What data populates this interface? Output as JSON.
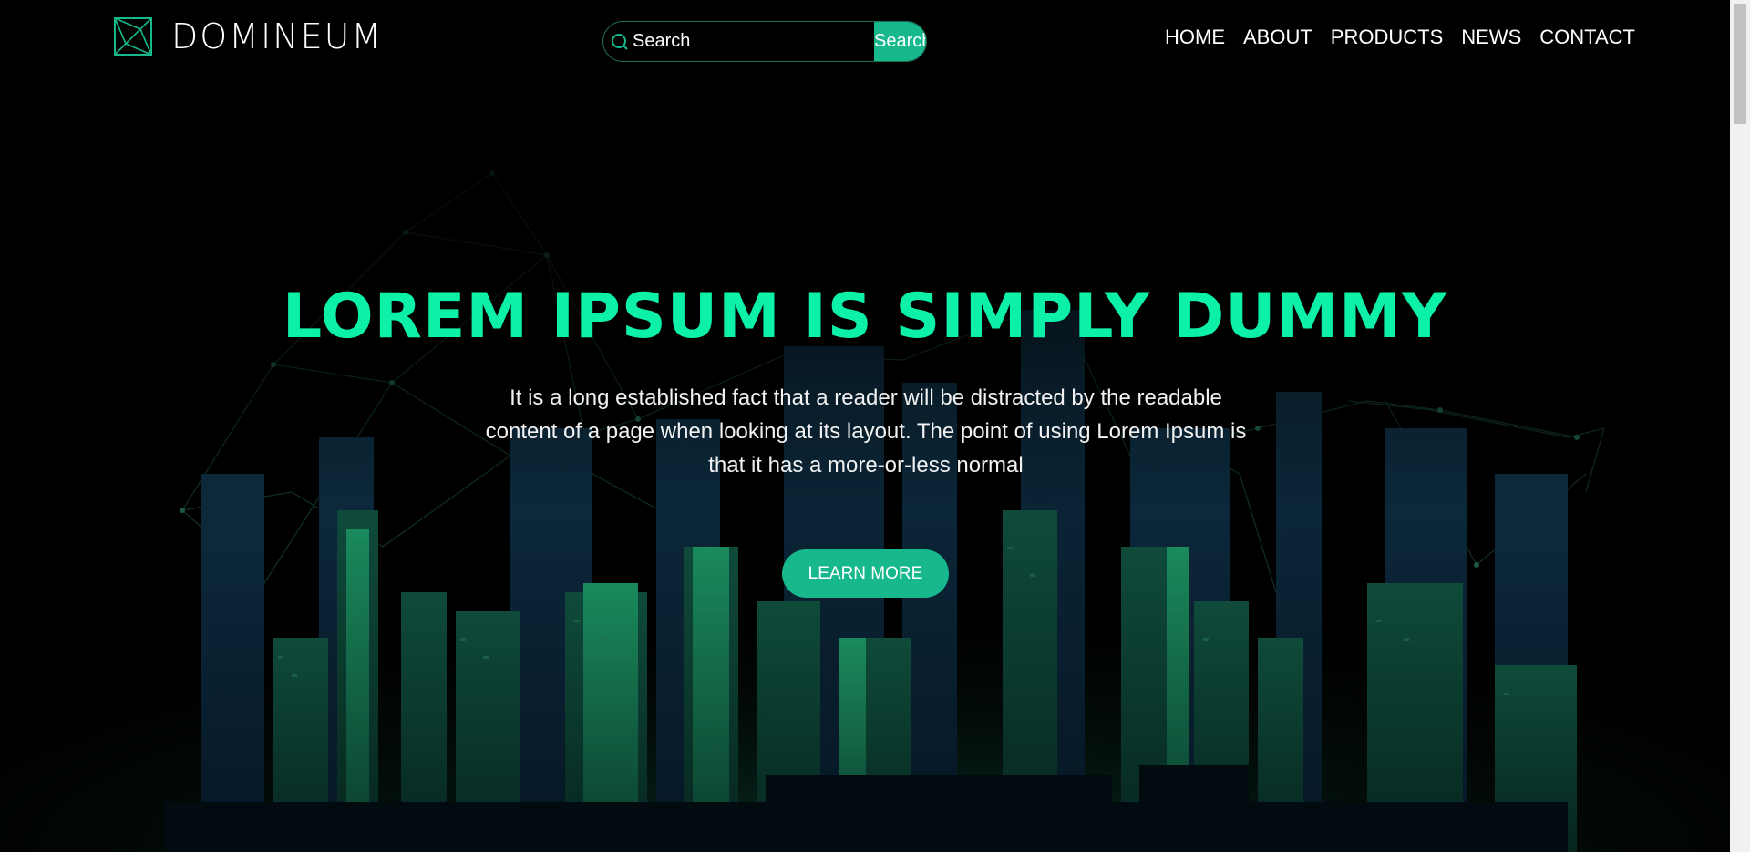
{
  "brand": {
    "name": "DOMINEUM",
    "logo_icon": "geometric-square-logo-icon"
  },
  "search": {
    "placeholder": "Search",
    "button_label": "Search",
    "icon": "search-icon"
  },
  "nav": {
    "items": [
      {
        "label": "HOME"
      },
      {
        "label": "ABOUT"
      },
      {
        "label": "PRODUCTS"
      },
      {
        "label": "NEWS"
      },
      {
        "label": "CONTACT"
      }
    ]
  },
  "hero": {
    "title": "LOREM IPSUM IS SIMPLY DUMMY",
    "text": "It is a long established fact that a reader will be distracted by the readable content of a page when looking at its layout. The point of using Lorem Ipsum is that it has a more-or-less normal",
    "button_label": "LEARN MORE"
  },
  "colors": {
    "accent": "#17b98c",
    "title": "#0cf0a8",
    "background": "#000000"
  }
}
